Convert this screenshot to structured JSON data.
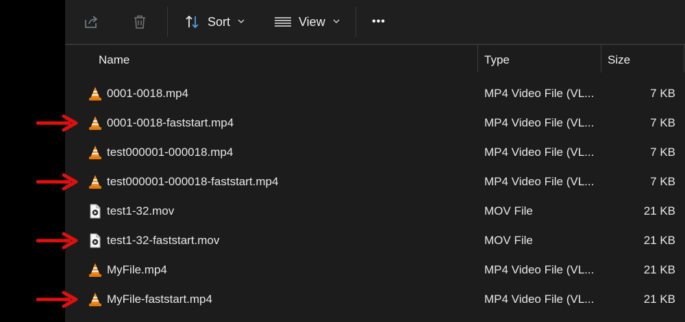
{
  "toolbar": {
    "share_icon": "share-icon",
    "delete_icon": "trash-icon",
    "sort_label": "Sort",
    "view_label": "View",
    "more_label": "•••"
  },
  "columns": {
    "name": "Name",
    "type": "Type",
    "size": "Size"
  },
  "files": [
    {
      "name": "0001-0018.mp4",
      "type": "MP4 Video File (VL...",
      "size": "7 KB",
      "icon": "vlc-icon",
      "marked": false
    },
    {
      "name": "0001-0018-faststart.mp4",
      "type": "MP4 Video File (VL...",
      "size": "7 KB",
      "icon": "vlc-icon",
      "marked": true
    },
    {
      "name": "test000001-000018.mp4",
      "type": "MP4 Video File (VL...",
      "size": "7 KB",
      "icon": "vlc-icon",
      "marked": false
    },
    {
      "name": "test000001-000018-faststart.mp4",
      "type": "MP4 Video File (VL...",
      "size": "7 KB",
      "icon": "vlc-icon",
      "marked": true
    },
    {
      "name": "test1-32.mov",
      "type": "MOV File",
      "size": "21 KB",
      "icon": "video-file-icon",
      "marked": false
    },
    {
      "name": "test1-32-faststart.mov",
      "type": "MOV File",
      "size": "21 KB",
      "icon": "video-file-icon",
      "marked": true
    },
    {
      "name": "MyFile.mp4",
      "type": "MP4 Video File (VL...",
      "size": "21 KB",
      "icon": "vlc-icon",
      "marked": false
    },
    {
      "name": "MyFile-faststart.mp4",
      "type": "MP4 Video File (VL...",
      "size": "21 KB",
      "icon": "vlc-icon",
      "marked": true
    }
  ],
  "colors": {
    "arrow": "#e01010",
    "vlc_orange": "#f18d1b"
  }
}
